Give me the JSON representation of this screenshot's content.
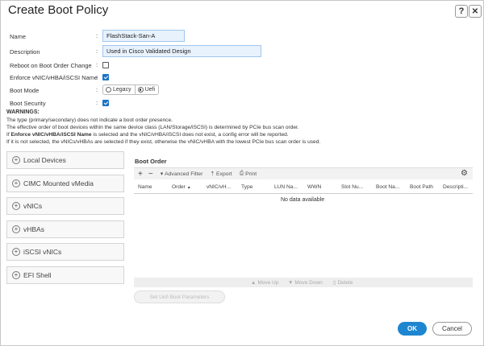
{
  "dialog": {
    "title": "Create Boot Policy",
    "help_label": "?",
    "close_label": "✕"
  },
  "form": {
    "name_label": "Name",
    "name_value": "FlashStack-San-A",
    "description_label": "Description",
    "description_value": "Used in Cisco Validated Design",
    "reboot_label": "Reboot on Boot Order Change",
    "reboot_checked": false,
    "enforce_label": "Enforce vNIC/vHBA/iSCSI Name",
    "enforce_checked": true,
    "boot_mode_label": "Boot Mode",
    "boot_mode_options": [
      "Legacy",
      "Uefi"
    ],
    "boot_mode_selected": "Uefi",
    "boot_security_label": "Boot Security",
    "boot_security_checked": true,
    "colon": ":"
  },
  "warnings": {
    "title": "WARNINGS:",
    "line1": "The type (primary/secondary) does not indicate a boot order presence.",
    "line2": "The effective order of boot devices within the same device class (LAN/Storage/iSCSI) is determined by PCIe bus scan order.",
    "line3_prefix": "If ",
    "line3_bold": "Enforce vNIC/vHBA/iSCSI Name",
    "line3_suffix": " is selected and the vNIC/vHBA/iSCSI does not exist, a config error will be reported.",
    "line4": "If it is not selected, the vNICs/vHBAs are selected if they exist, otherwise the vNIC/vHBA with the lowest PCIe bus scan order is used."
  },
  "left_panel": {
    "items": [
      "Local Devices",
      "CIMC Mounted vMedia",
      "vNICs",
      "vHBAs",
      "iSCSI vNICs",
      "EFI Shell"
    ]
  },
  "boot_order": {
    "title": "Boot Order",
    "toolbar": {
      "add_label": "+",
      "remove_label": "−",
      "filter_label": "Advanced Filter",
      "export_label": "Export",
      "print_label": "Print"
    },
    "columns": [
      "Name",
      "Order",
      "vNIC/vH...",
      "Type",
      "LUN Na...",
      "WWN",
      "Slot Nu...",
      "Boot Na...",
      "Boot Path",
      "Descripti..."
    ],
    "sort_indicator": "▲",
    "empty_text": "No data available",
    "move_up_label": "Move Up",
    "move_down_label": "Move Down",
    "delete_label": "Delete",
    "set_uefi_label": "Set Uefi Boot Parameters"
  },
  "footer": {
    "ok_label": "OK",
    "cancel_label": "Cancel"
  },
  "colors": {
    "primary_button": "#1e86d0",
    "input_background": "#e8f2fc",
    "checkbox_checked": "#1a73c7"
  }
}
